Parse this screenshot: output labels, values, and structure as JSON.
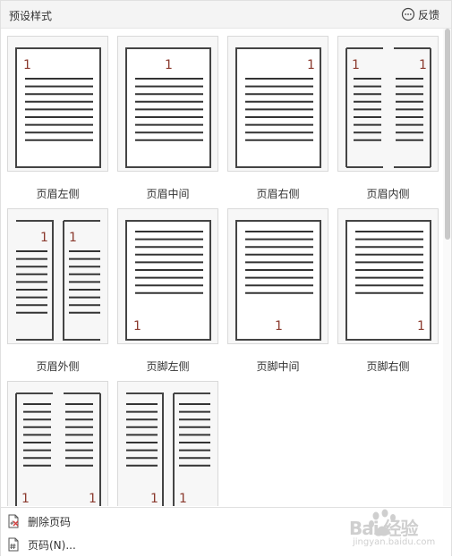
{
  "header": {
    "title": "预设样式",
    "feedback_label": "反馈"
  },
  "styles": [
    {
      "label": "页眉左侧",
      "page_number": "1",
      "variant": "header-left"
    },
    {
      "label": "页眉中间",
      "page_number": "1",
      "variant": "header-center"
    },
    {
      "label": "页眉右侧",
      "page_number": "1",
      "variant": "header-right"
    },
    {
      "label": "页眉内侧",
      "page_number": "1",
      "variant": "header-inside"
    },
    {
      "label": "页眉外侧",
      "page_number": "1",
      "variant": "header-outside"
    },
    {
      "label": "页脚左侧",
      "page_number": "1",
      "variant": "footer-left"
    },
    {
      "label": "页脚中间",
      "page_number": "1",
      "variant": "footer-center"
    },
    {
      "label": "页脚右侧",
      "page_number": "1",
      "variant": "footer-right"
    },
    {
      "label": "",
      "page_number": "1",
      "variant": "footer-outside"
    },
    {
      "label": "",
      "page_number": "1",
      "variant": "footer-inside"
    }
  ],
  "menu": {
    "delete_label": "删除页码",
    "page_number_label": "页码(N)..."
  },
  "watermark": {
    "text": "Bai 经验",
    "sub": "jingyan.baidu.com"
  },
  "colors": {
    "number": "#8b3a2e",
    "page_border": "#444444",
    "line": "#333333",
    "delete_icon": "#d23c3c"
  }
}
